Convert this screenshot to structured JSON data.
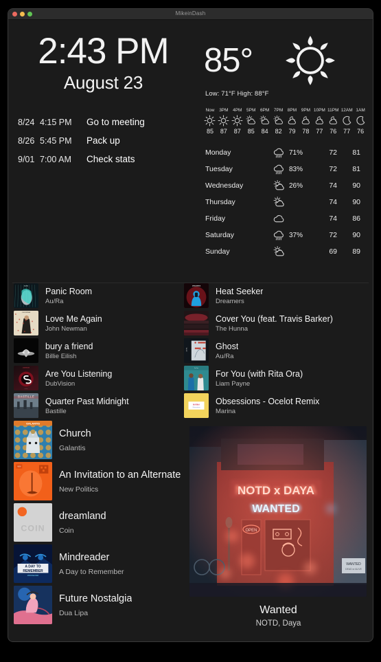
{
  "window": {
    "title": "MikeinDash"
  },
  "clock": {
    "time": "2:43 PM",
    "date": "August 23"
  },
  "calendar": {
    "events": [
      {
        "date": "8/24",
        "time": "4:15 PM",
        "title": "Go to meeting"
      },
      {
        "date": "8/26",
        "time": "5:45 PM",
        "title": "Pack up"
      },
      {
        "date": "9/01",
        "time": "7:00 AM",
        "title": "Check stats"
      }
    ]
  },
  "weather": {
    "current_temp": "85°",
    "current_icon": "sun-icon",
    "low_high": "Low: 71°F   High: 88°F",
    "hourly": [
      {
        "label": "Now",
        "icon": "sun-icon",
        "temp": "85"
      },
      {
        "label": "3PM",
        "icon": "sun-icon",
        "temp": "87"
      },
      {
        "label": "4PM",
        "icon": "sun-icon",
        "temp": "87"
      },
      {
        "label": "5PM",
        "icon": "sun-cloud-icon",
        "temp": "85"
      },
      {
        "label": "6PM",
        "icon": "sun-cloud-icon",
        "temp": "84"
      },
      {
        "label": "7PM",
        "icon": "sun-cloud-icon",
        "temp": "82"
      },
      {
        "label": "8PM",
        "icon": "moon-cloud-icon",
        "temp": "79"
      },
      {
        "label": "9PM",
        "icon": "moon-cloud-icon",
        "temp": "78"
      },
      {
        "label": "10PM",
        "icon": "moon-cloud-icon",
        "temp": "77"
      },
      {
        "label": "11PM",
        "icon": "moon-cloud-icon",
        "temp": "76"
      },
      {
        "label": "12AM",
        "icon": "moon-icon",
        "temp": "77"
      },
      {
        "label": "1AM",
        "icon": "moon-icon",
        "temp": "76"
      }
    ],
    "daily": [
      {
        "day": "Monday",
        "icon": "rain-icon",
        "pop": "71%",
        "low": "72",
        "high": "81"
      },
      {
        "day": "Tuesday",
        "icon": "rain-icon",
        "pop": "83%",
        "low": "72",
        "high": "81"
      },
      {
        "day": "Wednesday",
        "icon": "sun-cloud-icon",
        "pop": "26%",
        "low": "74",
        "high": "90"
      },
      {
        "day": "Thursday",
        "icon": "sun-cloud-icon",
        "pop": "",
        "low": "74",
        "high": "90"
      },
      {
        "day": "Friday",
        "icon": "cloud-icon",
        "pop": "",
        "low": "74",
        "high": "86"
      },
      {
        "day": "Saturday",
        "icon": "rain-icon",
        "pop": "37%",
        "low": "72",
        "high": "90"
      },
      {
        "day": "Sunday",
        "icon": "sun-cloud-icon",
        "pop": "",
        "low": "69",
        "high": "89"
      }
    ]
  },
  "music": {
    "left_tracks": [
      {
        "title": "Panic Room",
        "artist": "Au/Ra",
        "size": "s"
      },
      {
        "title": "Love Me Again",
        "artist": "John Newman",
        "size": "s"
      },
      {
        "title": "bury a friend",
        "artist": "Billie Eilish",
        "size": "s"
      },
      {
        "title": "Are You Listening",
        "artist": "DubVision",
        "size": "s"
      },
      {
        "title": "Quarter Past Midnight",
        "artist": "Bastille",
        "size": "s"
      },
      {
        "title": "Church",
        "artist": "Galantis",
        "size": "l"
      },
      {
        "title": "An Invitation to an Alternate Rea",
        "artist": "New Politics",
        "size": "l"
      },
      {
        "title": "dreamland",
        "artist": "Coin",
        "size": "l"
      },
      {
        "title": "Mindreader",
        "artist": "A Day to Remember",
        "size": "l"
      },
      {
        "title": "Future Nostalgia",
        "artist": "Dua Lipa",
        "size": "l"
      }
    ],
    "right_tracks": [
      {
        "title": "Heat Seeker",
        "artist": "Dreamers",
        "size": "s"
      },
      {
        "title": "Cover You (feat. Travis Barker)",
        "artist": "The Hunna",
        "size": "s"
      },
      {
        "title": "Ghost",
        "artist": "Au/Ra",
        "size": "s"
      },
      {
        "title": "For You (with Rita Ora)",
        "artist": "Liam Payne",
        "size": "s"
      },
      {
        "title": "Obsessions - Ocelot Remix",
        "artist": "Marina",
        "size": "s"
      }
    ],
    "now_playing": {
      "title": "Wanted",
      "artist": "NOTD, Daya",
      "art_sign_top": "NOTD x DAYA",
      "art_sign_bottom": "WANTED",
      "art_open_sign": "OPEN",
      "art_poster": "WANTED"
    }
  },
  "colors": {
    "background": "#1b1b1b",
    "titlebar": "#2c2c2c",
    "text_primary": "#f2f2f2",
    "text_secondary": "#b9b9b9",
    "neon_red": "#ff5a4d",
    "neon_blue": "#9fd8ff"
  }
}
